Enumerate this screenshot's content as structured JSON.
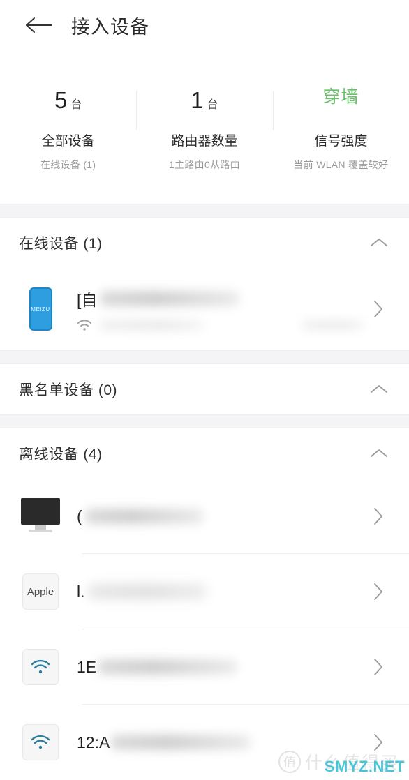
{
  "header": {
    "back_icon": "arrow-left-icon",
    "title": "接入设备"
  },
  "stats": [
    {
      "number": "5",
      "unit": "台",
      "label": "全部设备",
      "sub": "在线设备 (1)",
      "accent": false
    },
    {
      "number": "1",
      "unit": "台",
      "label": "路由器数量",
      "sub": "1主路由0从路由",
      "accent": false
    },
    {
      "number": "穿墙",
      "unit": "",
      "label": "信号强度",
      "sub": "当前 WLAN 覆盖较好",
      "accent": true
    }
  ],
  "sections": [
    {
      "title": "在线设备 (1)",
      "collapse_icon": "chevron-up-icon",
      "devices": [
        {
          "icon": "phone-meizu-icon",
          "icon_label": "MEIZU",
          "name_prefix": "[自",
          "name_blurred": true,
          "sub_icon": "wifi-signal-icon",
          "sub_blurred": true,
          "chevron": "chevron-right-icon"
        }
      ]
    },
    {
      "title": "黑名单设备 (0)",
      "collapse_icon": "chevron-up-icon",
      "devices": []
    },
    {
      "title": "离线设备 (4)",
      "collapse_icon": "chevron-up-icon",
      "devices": [
        {
          "icon": "monitor-icon",
          "icon_label": "",
          "name_prefix": "(",
          "name_blurred": true,
          "sub_icon": "",
          "sub_blurred": false,
          "chevron": "chevron-right-icon"
        },
        {
          "icon": "apple-badge-icon",
          "icon_label": "Apple",
          "name_prefix": "l.",
          "name_blurred": true,
          "sub_icon": "",
          "sub_blurred": false,
          "chevron": "chevron-right-icon"
        },
        {
          "icon": "wifi-icon",
          "icon_label": "",
          "name_prefix": "1E",
          "name_blurred": true,
          "sub_icon": "",
          "sub_blurred": false,
          "chevron": "chevron-right-icon"
        },
        {
          "icon": "wifi-icon",
          "icon_label": "",
          "name_prefix": "12:A",
          "name_blurred": true,
          "sub_icon": "",
          "sub_blurred": false,
          "chevron": "chevron-right-icon"
        }
      ]
    }
  ],
  "watermark": {
    "logo_char": "值",
    "text": "什么值得买",
    "site": "SMYZ.NET"
  },
  "colors": {
    "accent_green": "#6bc16b",
    "phone_blue": "#2e9ee0",
    "wifi_teal": "#2a7f9e",
    "band_gray": "#f4f4f6",
    "watermark_cyan": "#49c5d8"
  }
}
